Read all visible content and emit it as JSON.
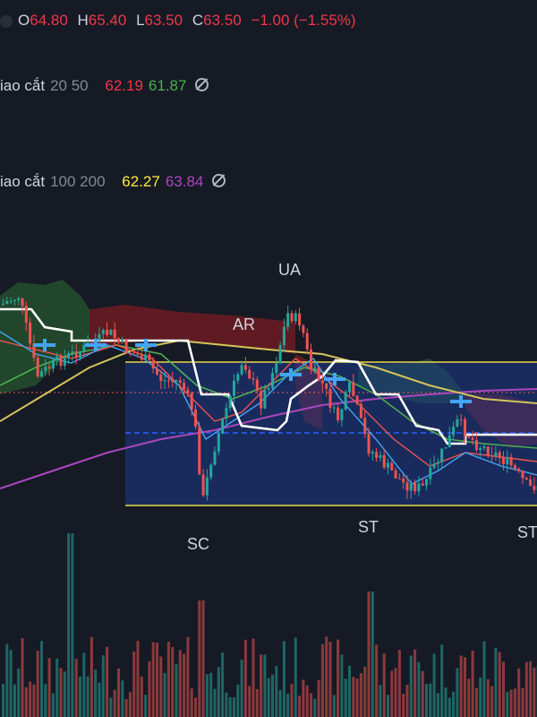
{
  "legend": {
    "ohlc": {
      "o_label": "O",
      "o_value": "64.80",
      "h_label": "H",
      "h_value": "65.40",
      "l_label": "L",
      "l_value": "63.50",
      "c_label": "C",
      "c_value": "63.50",
      "change": "−1.00 (−1.55%)"
    },
    "cross1": {
      "name": "iao cắt",
      "params": "20 50",
      "v1": "62.19",
      "v2": "61.87"
    },
    "cross2": {
      "name": "iao cắt",
      "params": "100 200",
      "v1": "62.27",
      "v2": "63.84"
    }
  },
  "colors": {
    "background": "#161a25",
    "up": "#26a69a",
    "down": "#ef5350",
    "value_red": "#f23645",
    "value_green": "#4caf50",
    "value_yellow": "#ffeb3b",
    "value_purple": "#ab47bc",
    "range_box": "#1e3a8a",
    "range_border": "#e6d84a"
  },
  "annotations": [
    {
      "text": "UA"
    },
    {
      "text": "AR"
    },
    {
      "text": "SC"
    },
    {
      "text": "ST"
    },
    {
      "text": "ST"
    }
  ],
  "chart_data": {
    "type": "candlestick",
    "ohlc_last": {
      "open": 64.8,
      "high": 65.4,
      "low": 63.5,
      "close": 63.5
    },
    "change": -1.0,
    "change_pct": -1.55,
    "indicators": [
      {
        "name": "iao cắt",
        "params": [
          20,
          50
        ],
        "values": [
          62.19,
          61.87
        ]
      },
      {
        "name": "iao cắt",
        "params": [
          100,
          200
        ],
        "values": [
          62.27,
          63.84
        ]
      }
    ],
    "wyckoff_labels": [
      "UA",
      "AR",
      "SC",
      "ST",
      "ST"
    ],
    "grid": false
  }
}
